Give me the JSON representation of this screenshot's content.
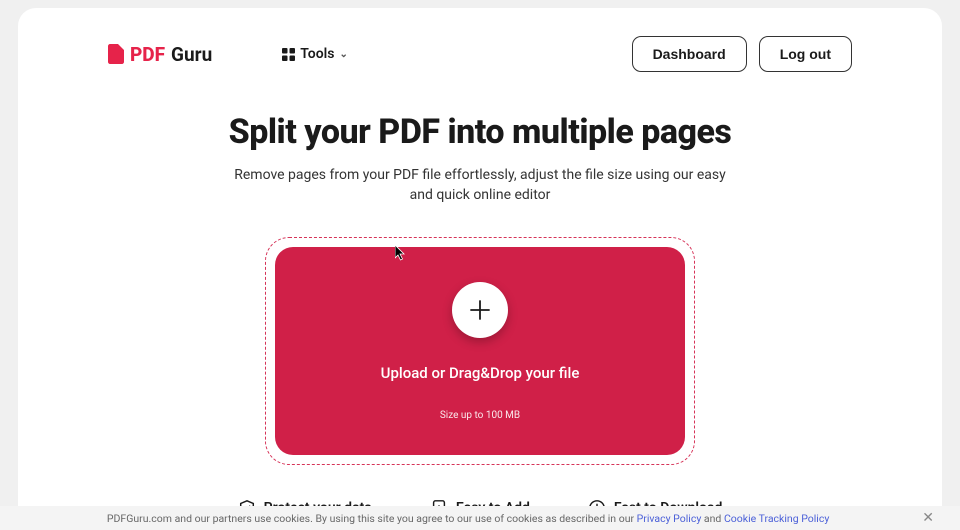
{
  "logo": {
    "pdf": "PDF",
    "guru": "Guru"
  },
  "nav": {
    "tools": "Tools"
  },
  "header_buttons": {
    "dashboard": "Dashboard",
    "logout": "Log out"
  },
  "page": {
    "title": "Split your PDF into multiple pages",
    "subtitle": "Remove pages from your PDF file effortlessly, adjust the file size using our easy and quick online editor"
  },
  "dropzone": {
    "label": "Upload or Drag&Drop your file",
    "hint": "Size up to 100 MB"
  },
  "features": [
    {
      "label": "Protect your data"
    },
    {
      "label": "Easy to Add"
    },
    {
      "label": "Fast to Download"
    }
  ],
  "cookie": {
    "prefix": "PDFGuru.com and our partners use cookies. By using this site you agree to our use of cookies as described in our ",
    "privacy": "Privacy Policy",
    "and": " and ",
    "tracking": "Cookie Tracking Policy"
  }
}
